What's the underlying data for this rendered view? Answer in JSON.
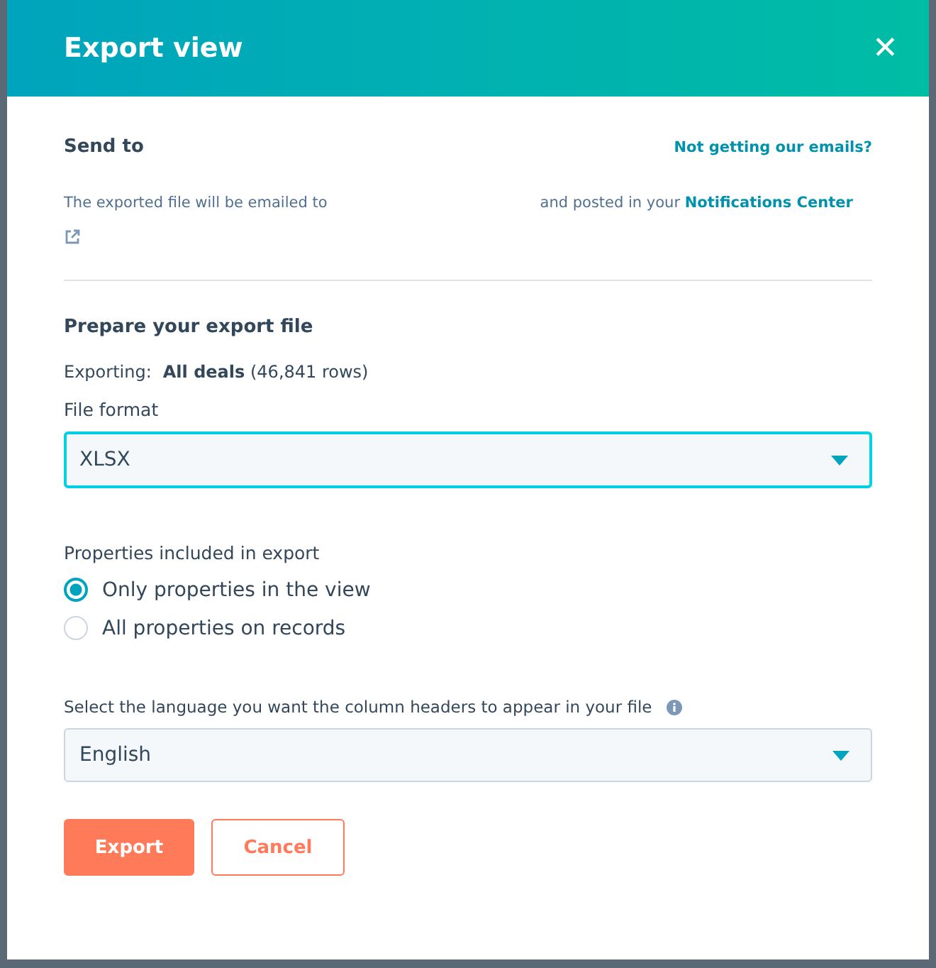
{
  "dialog": {
    "title": "Export view",
    "close_label": "✕"
  },
  "send_to": {
    "heading": "Send to",
    "help_link": "Not getting our emails?",
    "sentence_start": "The exported file will be emailed to",
    "sentence_end": "and posted in your",
    "link": "Notifications Center"
  },
  "prepare": {
    "heading": "Prepare your export file",
    "exporting_label": "Exporting:",
    "exporting_value": "**All deals** (46,841 rows)"
  },
  "file_format": {
    "label": "File format",
    "value": "XLSX",
    "focused": true
  },
  "properties": {
    "label": "Properties included in export",
    "options": [
      {
        "label": "Only properties in the view",
        "selected": true
      },
      {
        "label": "All properties on records",
        "selected": false
      }
    ]
  },
  "language": {
    "label": "Select the language you want the column headers to appear in your file",
    "value": "English",
    "focused": false
  },
  "buttons": [
    {
      "label": "Export",
      "kind": "primary"
    },
    {
      "label": "Cancel",
      "kind": "secondary"
    }
  ]
}
